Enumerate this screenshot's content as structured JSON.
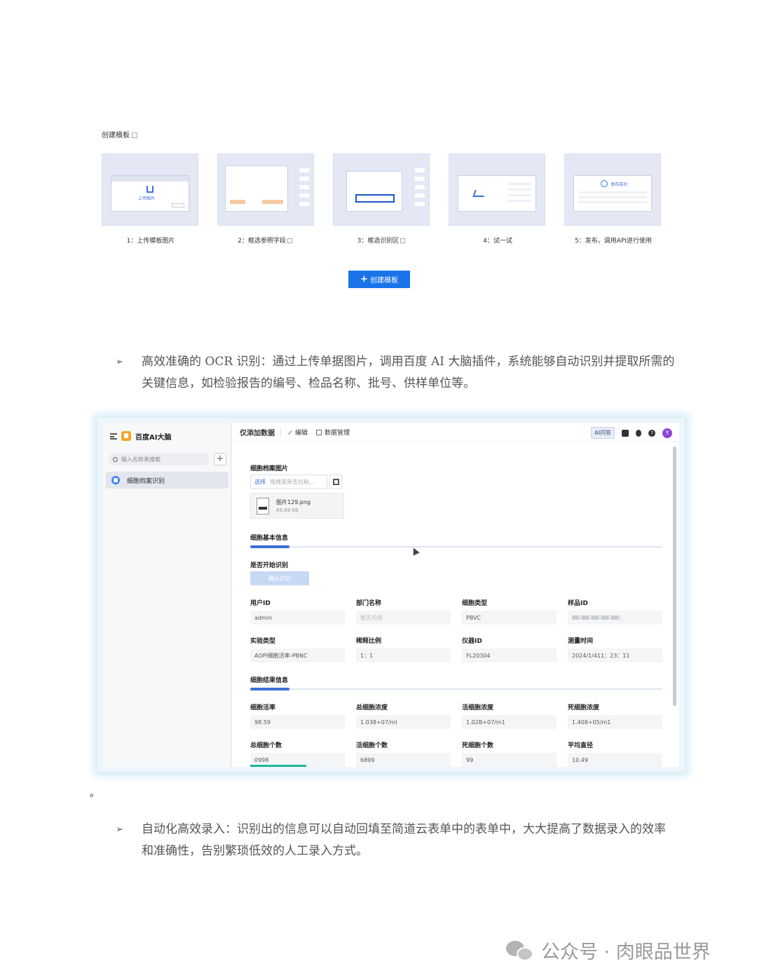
{
  "template_section": {
    "title": "创建模板",
    "steps": [
      {
        "label": "1：上传模板图片",
        "inner_text": "上传图片"
      },
      {
        "label": "2：框选参照字段"
      },
      {
        "label": "3：框选识别区"
      },
      {
        "label": "4：试一试"
      },
      {
        "label": "5：发布，调用API进行使用",
        "inner_text": "发布成功"
      }
    ],
    "create_button": "创建模板"
  },
  "paragraph1": {
    "arrow": "➢",
    "text": "高效准确的 OCR 识别：通过上传单据图片，调用百度 AI 大脑插件，系统能够自动识别并提取所需的关键信息，如检验报告的编号、检品名称、批号、供样单位等。"
  },
  "dot": "。",
  "app": {
    "brand": "百度AI大脑",
    "search_placeholder": "输入名称来搜索",
    "sidebar_item": "细胞档案识别",
    "topbar": {
      "title": "仅添加数据",
      "tab_edit": "编辑",
      "tab_data": "数据管理",
      "ai_tag": "AI问答",
      "avatar": "Y"
    },
    "upload": {
      "label": "细胞档案图片",
      "select": "选择",
      "placeholder": "拖拽或单击后粘...",
      "file_name": "图片129.png",
      "file_size": "89.69 KB"
    },
    "basic_section": "细胞基本信息",
    "start_label": "是否开始识别",
    "start_button": "确认识别",
    "fields_row1": [
      {
        "label": "用户ID",
        "value": "admin"
      },
      {
        "label": "部门名称",
        "value": "暂无内容"
      },
      {
        "label": "细胞类型",
        "value": "PBVC"
      },
      {
        "label": "样品ID",
        "value": ""
      }
    ],
    "fields_row2": [
      {
        "label": "实验类型",
        "value": "AOPI细胞活率-PBNC"
      },
      {
        "label": "稀释比例",
        "value": "1：1"
      },
      {
        "label": "仪器ID",
        "value": "FL20304"
      },
      {
        "label": "测量时间",
        "value": "2024/1/411：23：11"
      }
    ],
    "result_section": "细胞结果信息",
    "fields_row3": [
      {
        "label": "细胞活率",
        "value": "98.59"
      },
      {
        "label": "总细胞浓度",
        "value": "1.038+07/ml"
      },
      {
        "label": "活细胞浓度",
        "value": "1.02B+07/m1"
      },
      {
        "label": "死细胞浓度",
        "value": "1.408+05/m1"
      }
    ],
    "fields_row4": [
      {
        "label": "总细胞个数",
        "value": "0998"
      },
      {
        "label": "活细胞个数",
        "value": "6899"
      },
      {
        "label": "死细胞个数",
        "value": "99"
      },
      {
        "label": "平均直径",
        "value": "10.49"
      }
    ]
  },
  "paragraph2": {
    "arrow": "➢",
    "text": "自动化高效录入：识别出的信息可以自动回填至简道云表单中的表单中，大大提高了数据录入的效率和准确性，告别繁琐低效的人工录入方式。"
  },
  "watermark": {
    "text": "公众号 · 肉眼品世界"
  }
}
